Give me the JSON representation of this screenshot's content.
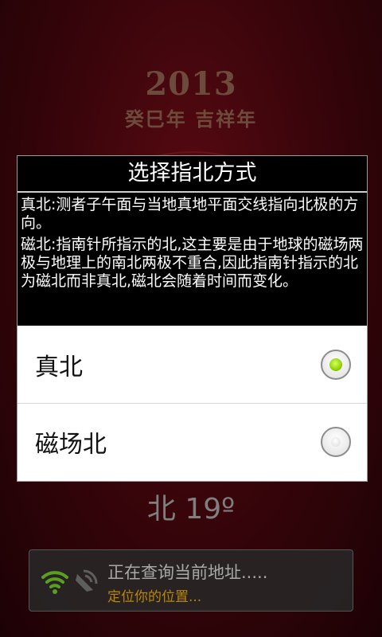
{
  "background": {
    "year": "2013",
    "year_subtitle": "癸巳年  吉祥年"
  },
  "dialog": {
    "title": "选择指北方式",
    "message": [
      "真北:测者子午面与当地真地平面交线指向北极的方向。",
      "磁北:指南针所指示的北,这主要是由于地球的磁场两极与地理上的南北两极不重合,因此指南针指示的北为磁北而非真北,磁北会随着时间而变化。"
    ],
    "options": [
      {
        "label": "真北",
        "selected": true
      },
      {
        "label": "磁场北",
        "selected": false
      }
    ]
  },
  "heading": {
    "text": "北 19º"
  },
  "toast": {
    "line1": "正在查询当前地址.....",
    "line2": "定位你的位置...",
    "icons": [
      "wifi-icon",
      "gps-icon"
    ]
  },
  "colors": {
    "accent_green": "#8fd400",
    "status_text": "#b8860b"
  }
}
